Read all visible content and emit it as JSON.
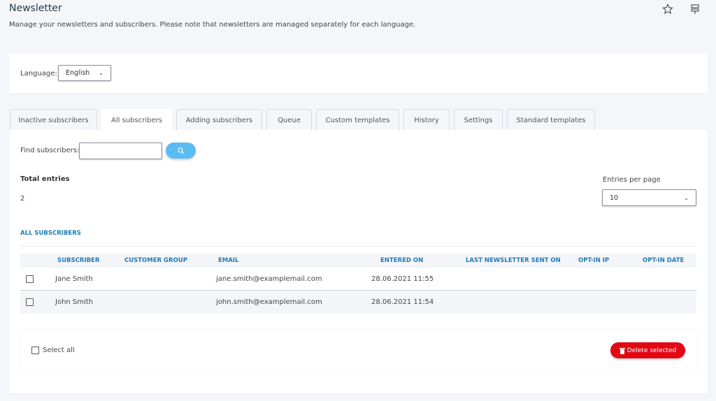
{
  "header": {
    "title": "Newsletter",
    "description": "Manage your newsletters and subscribers. Please note that newsletters are managed separately for each language.",
    "icons": [
      "star-icon",
      "pin-icon"
    ]
  },
  "language": {
    "label": "Language:",
    "value": "English"
  },
  "tabs": [
    {
      "label": "Inactive subscribers"
    },
    {
      "label": "All subscribers",
      "active": true
    },
    {
      "label": "Adding subscribers"
    },
    {
      "label": "Queue"
    },
    {
      "label": "Custom templates"
    },
    {
      "label": "History"
    },
    {
      "label": "Settings"
    },
    {
      "label": "Standard templates"
    }
  ],
  "search": {
    "label": "Find subscribers:",
    "value": "",
    "placeholder": ""
  },
  "totals": {
    "label": "Total entries",
    "value": "2"
  },
  "per_page": {
    "label": "Entries per page",
    "value": "10"
  },
  "section_title": "ALL SUBSCRIBERS",
  "table": {
    "columns": [
      "SUBSCRIBER",
      "CUSTOMER GROUP",
      "EMAIL",
      "ENTERED ON",
      "LAST NEWSLETTER SENT ON",
      "OPT-IN IP",
      "OPT-IN DATE"
    ],
    "rows": [
      {
        "subscriber": "Jane Smith",
        "group": "",
        "email": "jane.smith@examplemail.com",
        "entered": "28.06.2021 11:55",
        "last": "",
        "ip": "",
        "date": ""
      },
      {
        "subscriber": "John Smith",
        "group": "",
        "email": "john.smith@examplemail.com",
        "entered": "28.06.2021 11:54",
        "last": "",
        "ip": "",
        "date": ""
      }
    ]
  },
  "footer": {
    "select_all": "Select all",
    "delete_label": "Delete selected"
  },
  "colors": {
    "accent": "#1f7bb6",
    "search_button": "#5bbcf5",
    "delete": "#e30613"
  }
}
